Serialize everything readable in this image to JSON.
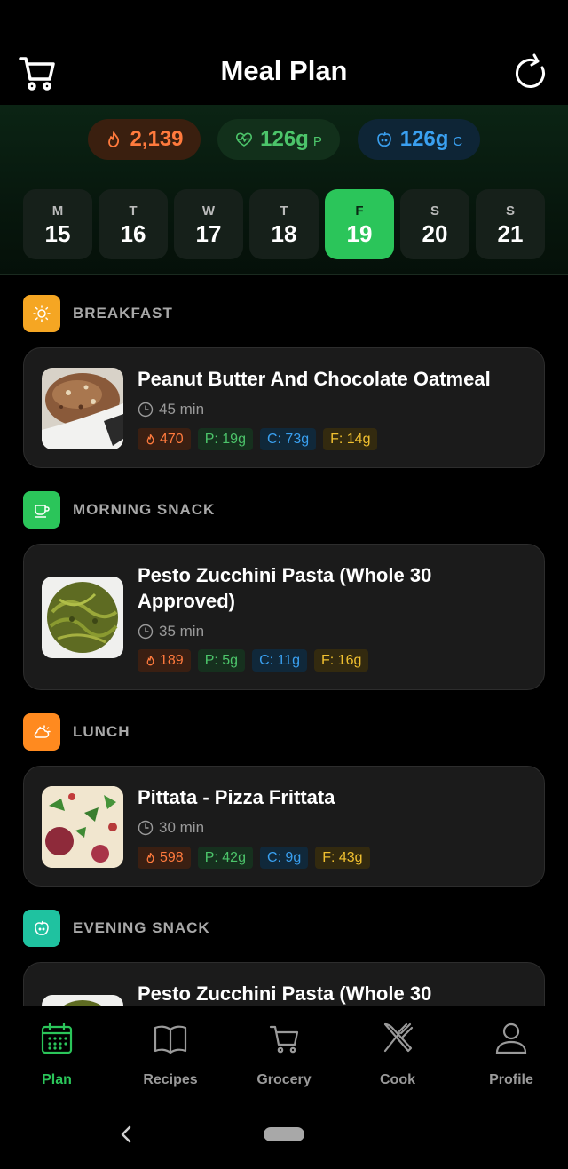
{
  "header": {
    "title": "Meal Plan",
    "cart_icon": "cart-icon",
    "refresh_icon": "refresh-icon"
  },
  "summary": {
    "calories": "2,139",
    "protein": "126g",
    "protein_unit": "P",
    "carbs": "126g",
    "carbs_unit": "C",
    "colors": {
      "calories": "#ff7a3d",
      "protein": "#4cc46a",
      "carbs": "#3aa0f0"
    }
  },
  "days": [
    {
      "letter": "M",
      "num": "15"
    },
    {
      "letter": "T",
      "num": "16"
    },
    {
      "letter": "W",
      "num": "17"
    },
    {
      "letter": "T",
      "num": "18"
    },
    {
      "letter": "F",
      "num": "19"
    },
    {
      "letter": "S",
      "num": "20"
    },
    {
      "letter": "S",
      "num": "21"
    }
  ],
  "selected_day": "19",
  "meals": [
    {
      "section": "BREAKFAST",
      "icon": "sun-icon",
      "color": "#f5a623",
      "name": "Peanut Butter And Chocolate Oatmeal",
      "time": "45 min",
      "cal": "470",
      "p": "P: 19g",
      "c": "C: 73g",
      "f": "F: 14g"
    },
    {
      "section": "MORNING SNACK",
      "icon": "coffee-cup-icon",
      "color": "#2bc55a",
      "name": "Pesto Zucchini Pasta (Whole 30 Approved)",
      "time": "35 min",
      "cal": "189",
      "p": "P: 5g",
      "c": "C: 11g",
      "f": "F: 16g"
    },
    {
      "section": "LUNCH",
      "icon": "cloud-sun-icon",
      "color": "#ff8a1f",
      "name": "Pittata - Pizza Frittata",
      "time": "30 min",
      "cal": "598",
      "p": "P: 42g",
      "c": "C: 9g",
      "f": "F: 43g"
    },
    {
      "section": "EVENING SNACK",
      "icon": "apple-icon",
      "color": "#1fc2a0",
      "name": "Pesto Zucchini Pasta (Whole 30"
    }
  ],
  "nav": [
    {
      "label": "Plan",
      "icon": "calendar-icon",
      "active": true
    },
    {
      "label": "Recipes",
      "icon": "book-icon"
    },
    {
      "label": "Grocery",
      "icon": "cart-icon"
    },
    {
      "label": "Cook",
      "icon": "utensils-icon"
    },
    {
      "label": "Profile",
      "icon": "user-icon"
    }
  ]
}
